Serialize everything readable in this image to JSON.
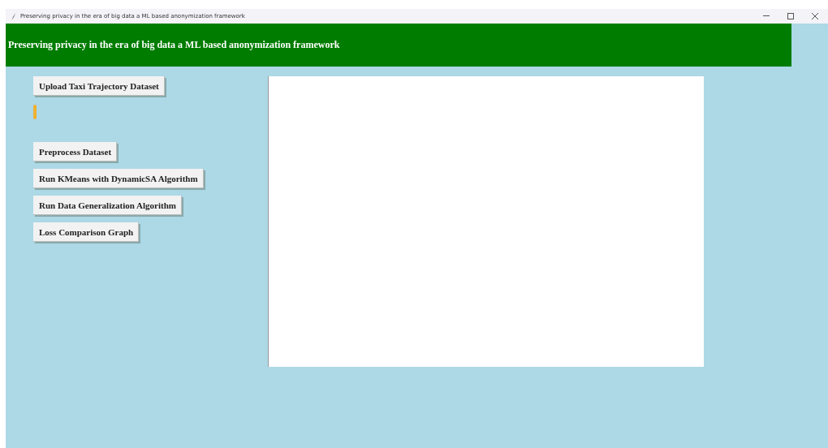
{
  "window": {
    "title": "Preserving privacy in the era of big data a ML based anonymization framework"
  },
  "banner": {
    "title": "Preserving privacy in the era of big data a ML based anonymization framework"
  },
  "buttons": [
    {
      "label": "Upload Taxi Trajectory Dataset"
    },
    {
      "label": "Preprocess Dataset"
    },
    {
      "label": "Run KMeans with DynamicSA Algorithm"
    },
    {
      "label": "Run Data Generalization Algorithm"
    },
    {
      "label": "Loss Comparison Graph"
    }
  ]
}
